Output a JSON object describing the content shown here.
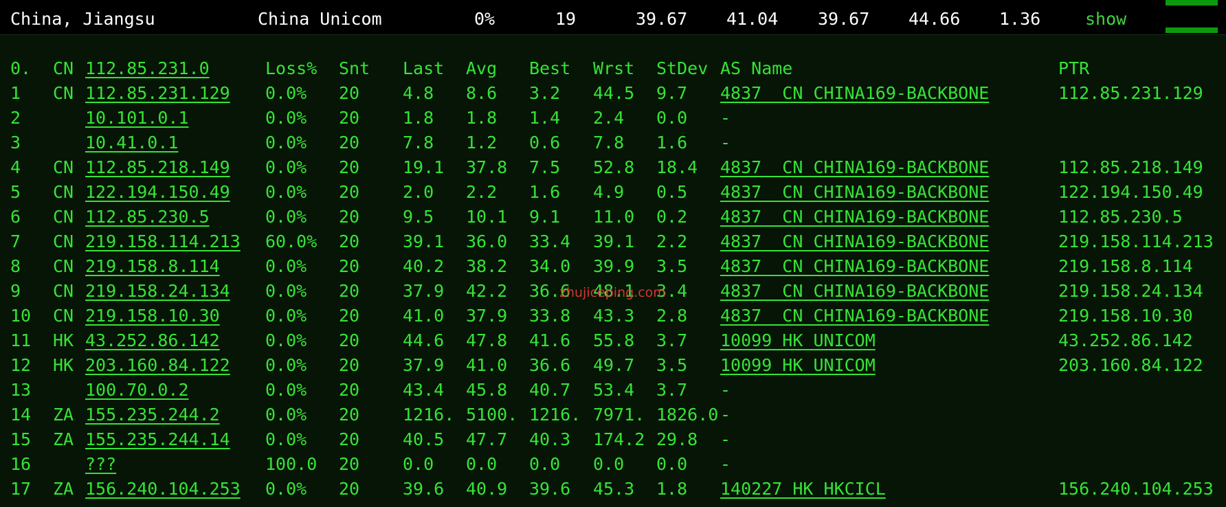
{
  "summary": {
    "location": "China, Jiangsu",
    "isp": "China Unicom",
    "loss": "0%",
    "sent": "19",
    "last": "39.67",
    "avg": "41.04",
    "best": "39.67",
    "worst": "44.66",
    "stdev": "1.36",
    "show_label": "show"
  },
  "header": {
    "index": "0.",
    "cc": "CN",
    "host": "112.85.231.0",
    "loss": "Loss%",
    "snt": "Snt",
    "last": "Last",
    "avg": "Avg",
    "best": "Best",
    "wrst": "Wrst",
    "stdev": "StDev",
    "asname": "AS Name",
    "ptr": "PTR"
  },
  "hops": [
    {
      "index": "1",
      "cc": "CN",
      "host": "112.85.231.129",
      "loss": "0.0%",
      "snt": "20",
      "last": "4.8",
      "avg": "8.6",
      "best": "3.2",
      "wrst": "44.5",
      "stdev": "9.7",
      "as": "4837  CN CHINA169-BACKBONE",
      "ptr": "112.85.231.129"
    },
    {
      "index": "2",
      "cc": "",
      "host": "10.101.0.1",
      "loss": "0.0%",
      "snt": "20",
      "last": "1.8",
      "avg": "1.8",
      "best": "1.4",
      "wrst": "2.4",
      "stdev": "0.0",
      "as": "-",
      "ptr": ""
    },
    {
      "index": "3",
      "cc": "",
      "host": "10.41.0.1",
      "loss": "0.0%",
      "snt": "20",
      "last": "7.8",
      "avg": "1.2",
      "best": "0.6",
      "wrst": "7.8",
      "stdev": "1.6",
      "as": "-",
      "ptr": ""
    },
    {
      "index": "4",
      "cc": "CN",
      "host": "112.85.218.149",
      "loss": "0.0%",
      "snt": "20",
      "last": "19.1",
      "avg": "37.8",
      "best": "7.5",
      "wrst": "52.8",
      "stdev": "18.4",
      "as": "4837  CN CHINA169-BACKBONE",
      "ptr": "112.85.218.149"
    },
    {
      "index": "5",
      "cc": "CN",
      "host": "122.194.150.49",
      "loss": "0.0%",
      "snt": "20",
      "last": "2.0",
      "avg": "2.2",
      "best": "1.6",
      "wrst": "4.9",
      "stdev": "0.5",
      "as": "4837  CN CHINA169-BACKBONE",
      "ptr": "122.194.150.49"
    },
    {
      "index": "6",
      "cc": "CN",
      "host": "112.85.230.5",
      "loss": "0.0%",
      "snt": "20",
      "last": "9.5",
      "avg": "10.1",
      "best": "9.1",
      "wrst": "11.0",
      "stdev": "0.2",
      "as": "4837  CN CHINA169-BACKBONE",
      "ptr": "112.85.230.5"
    },
    {
      "index": "7",
      "cc": "CN",
      "host": "219.158.114.213",
      "loss": "60.0%",
      "snt": "20",
      "last": "39.1",
      "avg": "36.0",
      "best": "33.4",
      "wrst": "39.1",
      "stdev": "2.2",
      "as": "4837  CN CHINA169-BACKBONE",
      "ptr": "219.158.114.213"
    },
    {
      "index": "8",
      "cc": "CN",
      "host": "219.158.8.114",
      "loss": "0.0%",
      "snt": "20",
      "last": "40.2",
      "avg": "38.2",
      "best": "34.0",
      "wrst": "39.9",
      "stdev": "3.5",
      "as": "4837  CN CHINA169-BACKBONE",
      "ptr": "219.158.8.114"
    },
    {
      "index": "9",
      "cc": "CN",
      "host": "219.158.24.134",
      "loss": "0.0%",
      "snt": "20",
      "last": "37.9",
      "avg": "42.2",
      "best": "36.6",
      "wrst": "48.1",
      "stdev": "3.4",
      "as": "4837  CN CHINA169-BACKBONE",
      "ptr": "219.158.24.134"
    },
    {
      "index": "10",
      "cc": "CN",
      "host": "219.158.10.30",
      "loss": "0.0%",
      "snt": "20",
      "last": "41.0",
      "avg": "37.9",
      "best": "33.8",
      "wrst": "43.3",
      "stdev": "2.8",
      "as": "4837  CN CHINA169-BACKBONE",
      "ptr": "219.158.10.30"
    },
    {
      "index": "11",
      "cc": "HK",
      "host": "43.252.86.142",
      "loss": "0.0%",
      "snt": "20",
      "last": "44.6",
      "avg": "47.8",
      "best": "41.6",
      "wrst": "55.8",
      "stdev": "3.7",
      "as": "10099 HK UNICOM",
      "ptr": "43.252.86.142"
    },
    {
      "index": "12",
      "cc": "HK",
      "host": "203.160.84.122",
      "loss": "0.0%",
      "snt": "20",
      "last": "37.9",
      "avg": "41.0",
      "best": "36.6",
      "wrst": "49.7",
      "stdev": "3.5",
      "as": "10099 HK UNICOM",
      "ptr": "203.160.84.122"
    },
    {
      "index": "13",
      "cc": "",
      "host": "100.70.0.2",
      "loss": "0.0%",
      "snt": "20",
      "last": "43.4",
      "avg": "45.8",
      "best": "40.7",
      "wrst": "53.4",
      "stdev": "3.7",
      "as": "-",
      "ptr": ""
    },
    {
      "index": "14",
      "cc": "ZA",
      "host": "155.235.244.2",
      "loss": "0.0%",
      "snt": "20",
      "last": "1216.",
      "avg": "5100.",
      "best": "1216.",
      "wrst": "7971.",
      "stdev": "1826.0",
      "as": "-",
      "ptr": ""
    },
    {
      "index": "15",
      "cc": "ZA",
      "host": "155.235.244.14",
      "loss": "0.0%",
      "snt": "20",
      "last": "40.5",
      "avg": "47.7",
      "best": "40.3",
      "wrst": "174.2",
      "stdev": "29.8",
      "as": "-",
      "ptr": ""
    },
    {
      "index": "16",
      "cc": "",
      "host": "???",
      "loss": "100.0",
      "snt": "20",
      "last": "0.0",
      "avg": "0.0",
      "best": "0.0",
      "wrst": "0.0",
      "stdev": "0.0",
      "as": "-",
      "ptr": ""
    },
    {
      "index": "17",
      "cc": "ZA",
      "host": "156.240.104.253",
      "loss": "0.0%",
      "snt": "20",
      "last": "39.6",
      "avg": "40.9",
      "best": "39.6",
      "wrst": "45.3",
      "stdev": "1.8",
      "as": "140227 HK HKCICL",
      "ptr": "156.240.104.253"
    }
  ],
  "watermark": "zhujiceping.com",
  "colors": {
    "terminal_green": "#36e336",
    "panel_bg": "#061506",
    "top_bg": "#000000",
    "accent_bar": "#0c9a0c",
    "watermark_red": "#e63a3a"
  }
}
